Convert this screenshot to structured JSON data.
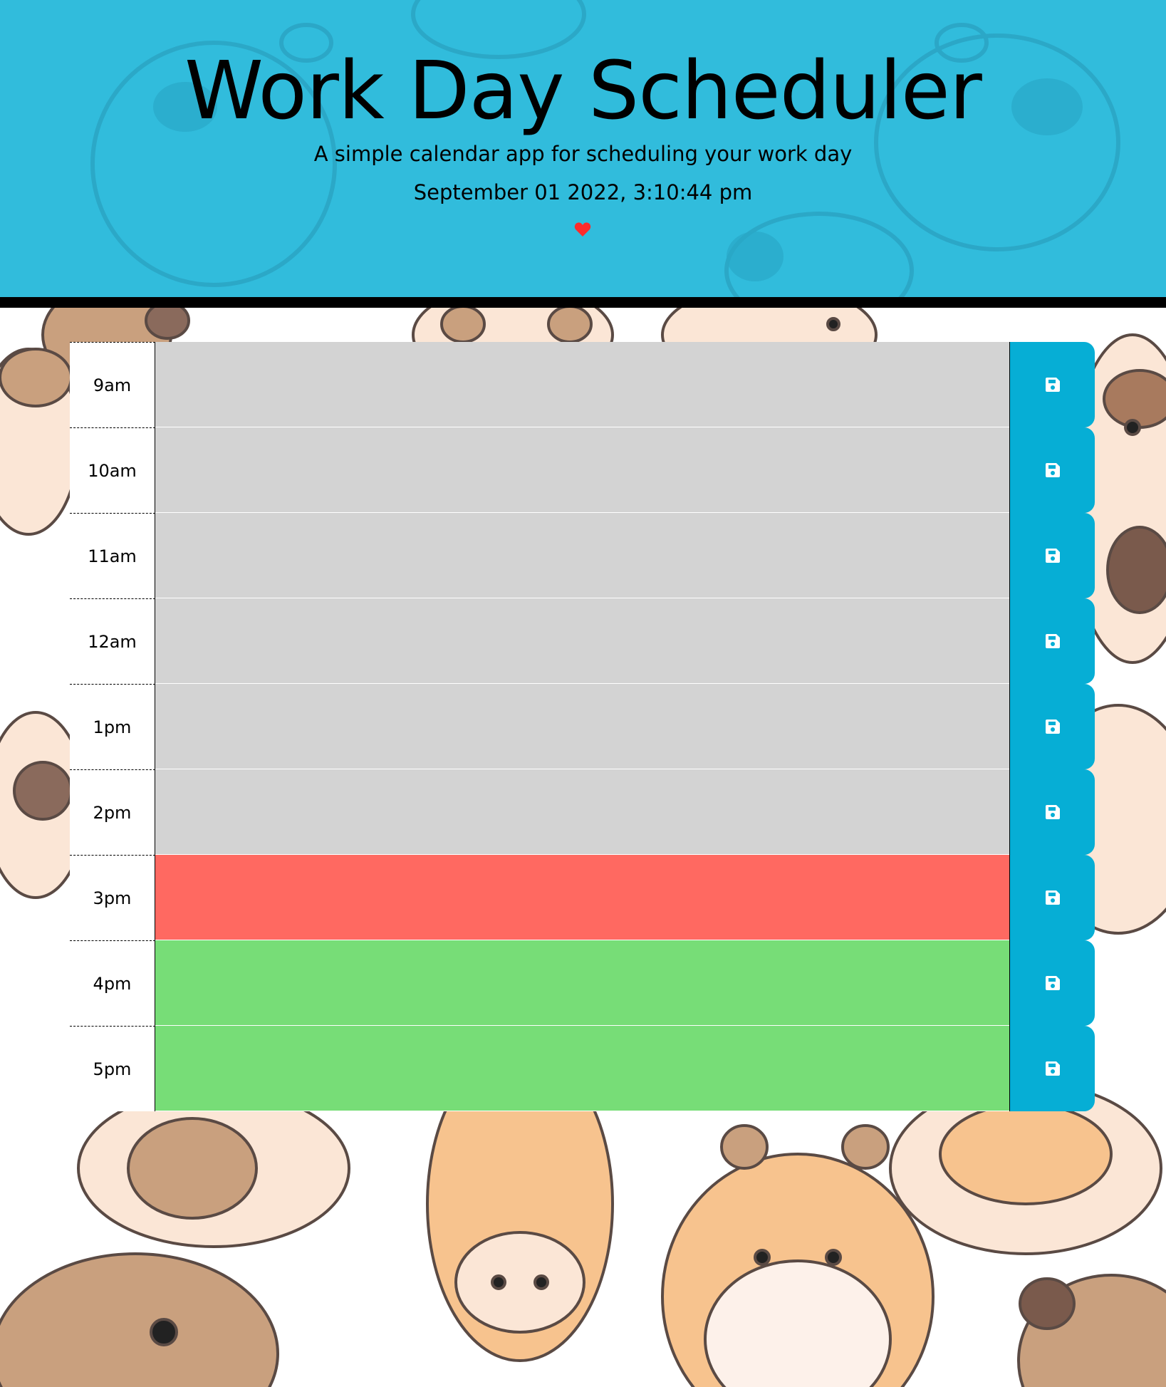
{
  "header": {
    "title": "Work Day Scheduler",
    "subtitle": "A simple calendar app for scheduling your work day",
    "current_date": "September 01 2022, 3:10:44 pm",
    "heart_icon": "heart-icon",
    "heart_color": "#ff2a2a",
    "background_color": "#31bcdc"
  },
  "colors": {
    "past": "#d3d3d3",
    "present": "#ff6961",
    "future": "#77dd77",
    "save_button": "#06aed5"
  },
  "schedule": {
    "rows": [
      {
        "hour": "9am",
        "status": "past",
        "text": "",
        "save_icon": "save-icon"
      },
      {
        "hour": "10am",
        "status": "past",
        "text": "",
        "save_icon": "save-icon"
      },
      {
        "hour": "11am",
        "status": "past",
        "text": "",
        "save_icon": "save-icon"
      },
      {
        "hour": "12am",
        "status": "past",
        "text": "",
        "save_icon": "save-icon"
      },
      {
        "hour": "1pm",
        "status": "past",
        "text": "",
        "save_icon": "save-icon"
      },
      {
        "hour": "2pm",
        "status": "past",
        "text": "",
        "save_icon": "save-icon"
      },
      {
        "hour": "3pm",
        "status": "present",
        "text": "",
        "save_icon": "save-icon"
      },
      {
        "hour": "4pm",
        "status": "future",
        "text": "",
        "save_icon": "save-icon"
      },
      {
        "hour": "5pm",
        "status": "future",
        "text": "",
        "save_icon": "save-icon"
      }
    ]
  }
}
